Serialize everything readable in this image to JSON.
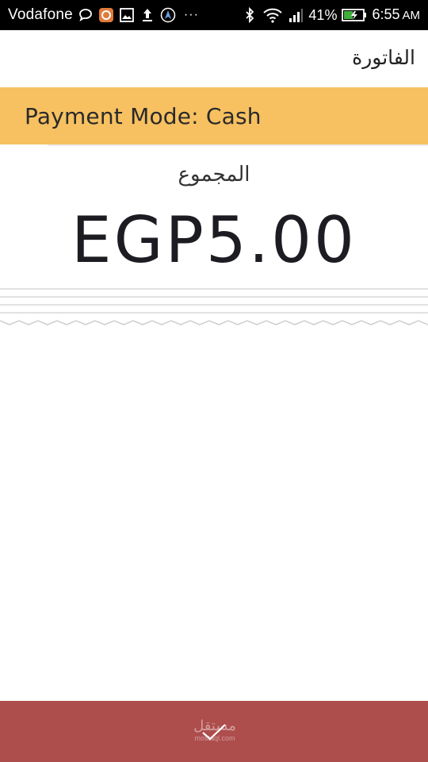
{
  "status_bar": {
    "carrier": "Vodafone",
    "more_indicator": "···",
    "battery_percent": "41%",
    "time": "6:55",
    "ampm": "AM",
    "icons": [
      "chat-bubble-icon",
      "app-notification-icon",
      "image-icon",
      "upload-icon",
      "navigation-icon",
      "bluetooth-icon",
      "wifi-icon",
      "signal-icon",
      "battery-charging-icon"
    ]
  },
  "header": {
    "title": "الفاتورة"
  },
  "payment": {
    "mode_text": "Payment Mode: Cash",
    "banner_color": "#f7c161"
  },
  "total": {
    "label": "المجموع",
    "amount": "EGP5.00"
  },
  "confirm": {
    "icon": "check-icon",
    "color": "#ad4d4c"
  },
  "watermark": {
    "arabic": "مستقل",
    "latin": "mostaql.com"
  }
}
